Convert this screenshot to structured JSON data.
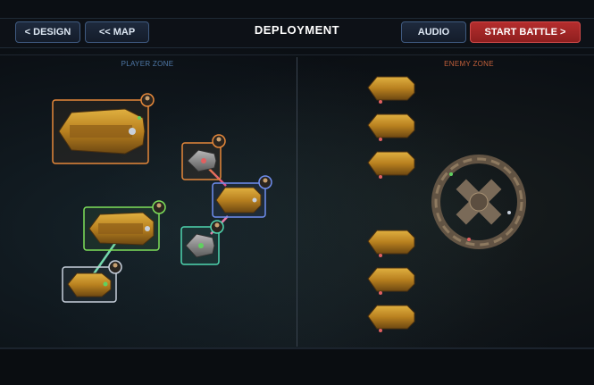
{
  "header": {
    "title": "DEPLOYMENT",
    "design_label": "< DESIGN",
    "map_label": "<< MAP",
    "audio_label": "AUDIO",
    "start_label": "START BATTLE >"
  },
  "zones": {
    "player_label": "PLAYER ZONE",
    "enemy_label": "ENEMY ZONE"
  },
  "colors": {
    "player_zone_label": "#4f78a8",
    "enemy_zone_label": "#c2603a",
    "start_button": "#a82727",
    "selection_orange": "#e6883a",
    "selection_blue": "#6f8ef0",
    "selection_green": "#7ee05a",
    "selection_teal": "#4fd6b0",
    "selection_white": "#c8d0dc"
  },
  "icons": {
    "captain_portrait": "captain-portrait-icon",
    "link_line": "fleet-link-line"
  }
}
